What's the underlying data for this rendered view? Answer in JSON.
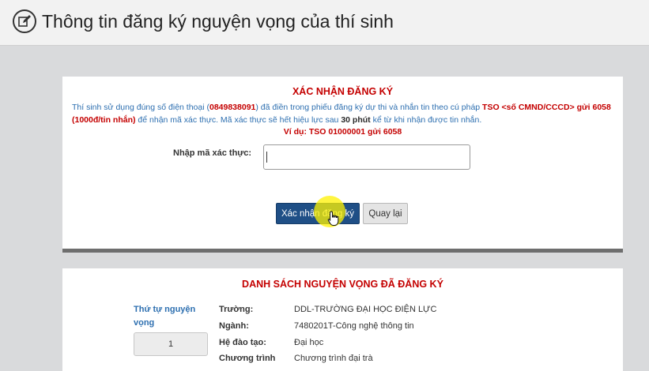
{
  "header": {
    "title": "Thông tin đăng ký nguyện vọng của thí sinh",
    "icon": "edit-icon"
  },
  "confirm": {
    "title": "XÁC NHẬN ĐĂNG KÝ",
    "instruction": {
      "part1": "Thí sinh sử dụng đúng số điện thoại (",
      "phone": "0849838091",
      "part2": ") đã điền trong phiếu đăng ký dự thi và nhắn tin theo cú pháp ",
      "syntax": "TSO <số CMND/CCCD> gửi 6058 (1000đ/tin nhắn)",
      "part3": " để nhận mã xác thực. Mã xác thực sẽ hết hiệu lực sau ",
      "validity": "30 phút",
      "part4": " kể từ khi nhận được tin nhắn."
    },
    "example": "Ví dụ: TSO 01000001 gửi 6058",
    "code_label": "Nhập mã xác thực:",
    "code_value": "",
    "confirm_button": "Xác nhận đăng ký",
    "back_button": "Quay lại"
  },
  "list": {
    "title": "DANH SÁCH NGUYỆN VỌNG ĐÃ ĐĂNG KÝ",
    "order_label": "Thứ tự nguyện vọng",
    "order_value": "1",
    "rows": [
      {
        "label": "Trường:",
        "value": "DDL-TRƯỜNG ĐẠI HỌC ĐIỆN LỰC"
      },
      {
        "label": "Ngành:",
        "value": "7480201T-Công nghệ thông tin"
      },
      {
        "label": "Hệ đào tạo:",
        "value": "Đại học"
      },
      {
        "label": "Chương trình",
        "value": "Chương trình đại trà"
      }
    ]
  },
  "colors": {
    "accent_red": "#c40000",
    "link_blue": "#2d6fb0",
    "button_blue": "#1f4f86",
    "highlight_yellow": "#fff200"
  }
}
